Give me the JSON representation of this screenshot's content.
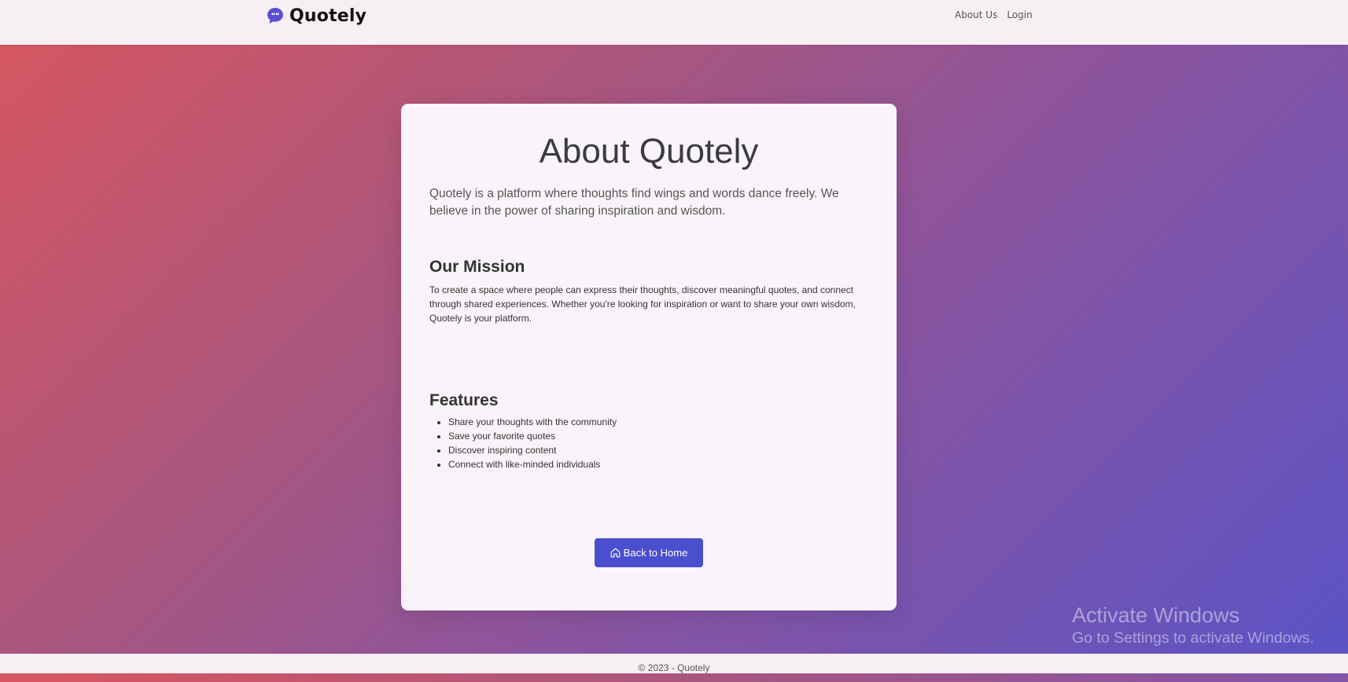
{
  "navbar": {
    "brand": "Quotely",
    "links": [
      "About Us",
      "Login"
    ]
  },
  "card": {
    "title": "About Quotely",
    "lead": "Quotely is a platform where thoughts find wings and words dance freely. We believe in the power of sharing inspiration and wisdom.",
    "mission_heading": "Our Mission",
    "mission_text": "To create a space where people can express their thoughts, discover meaningful quotes, and connect through shared experiences. Whether you're looking for inspiration or want to share your own wisdom, Quotely is your platform.",
    "features_heading": "Features",
    "features": [
      "Share your thoughts with the community",
      "Save your favorite quotes",
      "Discover inspiring content",
      "Connect with like-minded individuals"
    ],
    "back_button": "Back to Home"
  },
  "watermark": {
    "title": "Activate Windows",
    "subtitle": "Go to Settings to activate Windows."
  },
  "footer": {
    "text": "© 2023 - Quotely"
  },
  "colors": {
    "accent": "#4a4fce",
    "brand_icon": "#5a4fd0",
    "bg_gradient_start": "#d9565f",
    "bg_gradient_end": "#5a53c6"
  },
  "icons": {
    "brand": "quote-bubble-icon",
    "back": "home-icon"
  }
}
